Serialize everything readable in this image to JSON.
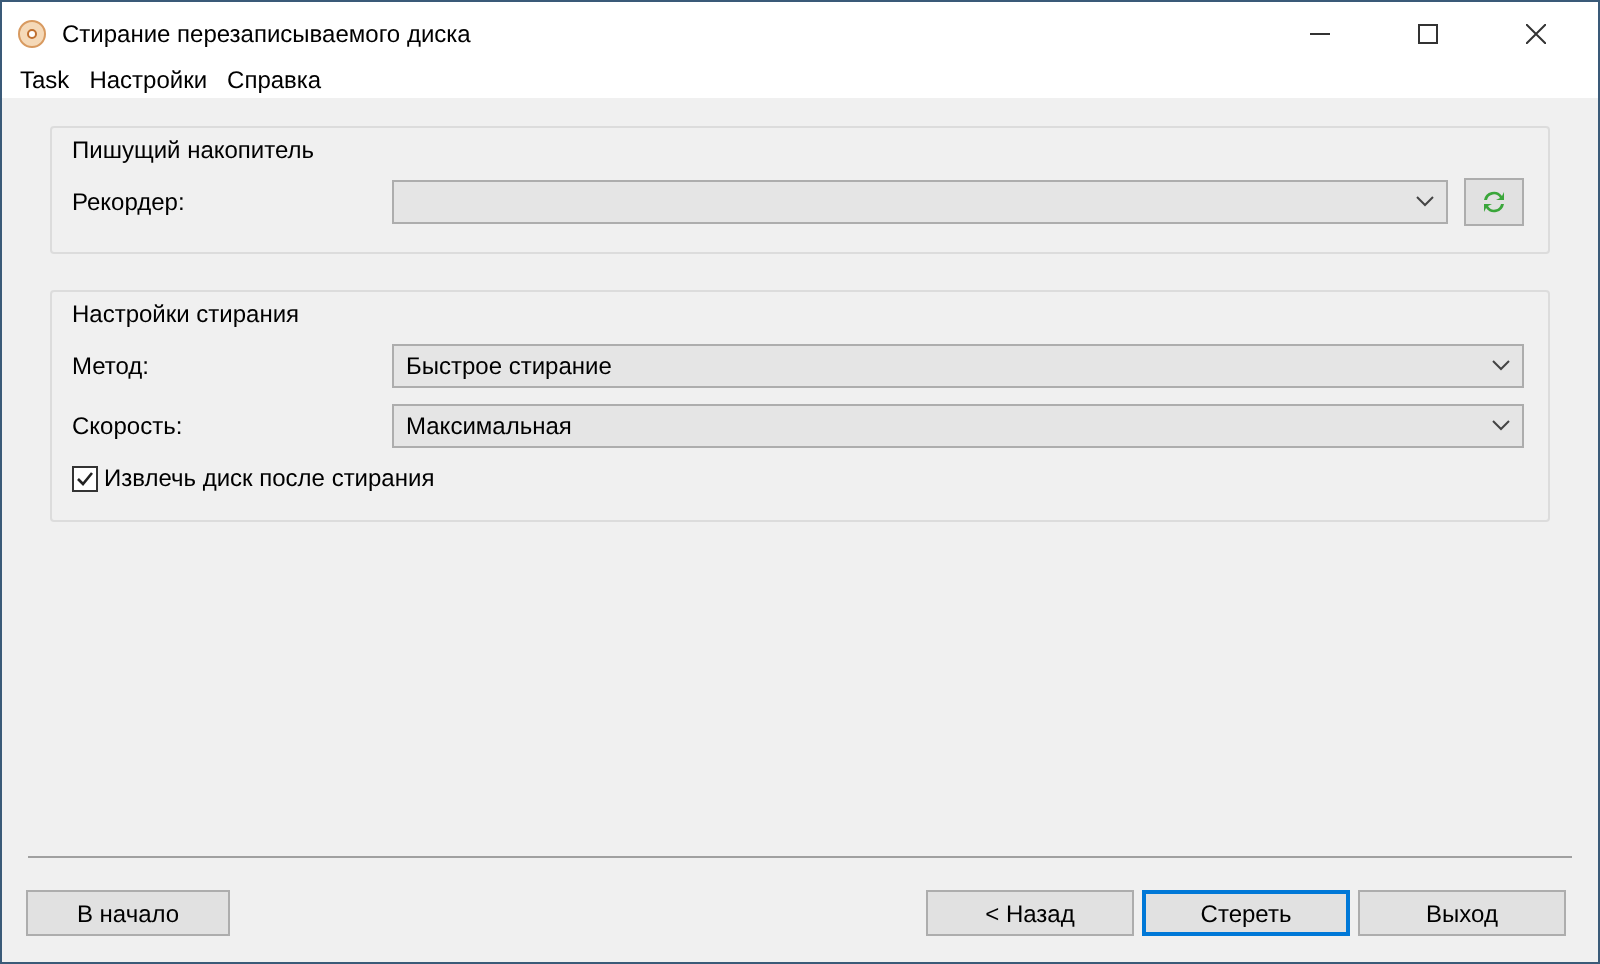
{
  "window": {
    "title": "Стирание перезаписываемого диска"
  },
  "menu": [
    "Task",
    "Настройки",
    "Справка"
  ],
  "groups": [
    {
      "title": "Пишущий накопитель",
      "rows": [
        {
          "kind": "select",
          "label": "Рекордер:",
          "value": "",
          "refresh": true
        }
      ]
    },
    {
      "title": "Настройки стирания",
      "rows": [
        {
          "kind": "select",
          "label": "Метод:",
          "value": "Быстрое стирание",
          "refresh": false
        },
        {
          "kind": "select",
          "label": "Скорость:",
          "value": "Максимальная",
          "refresh": false
        },
        {
          "kind": "checkbox",
          "label": "Извлечь диск после стирания",
          "checked": true
        }
      ]
    }
  ],
  "buttons": [
    {
      "label": "В начало",
      "focused": false
    },
    {
      "label": "< Назад",
      "focused": false
    },
    {
      "label": "Стереть",
      "focused": true
    },
    {
      "label": "Выход",
      "focused": false
    }
  ]
}
